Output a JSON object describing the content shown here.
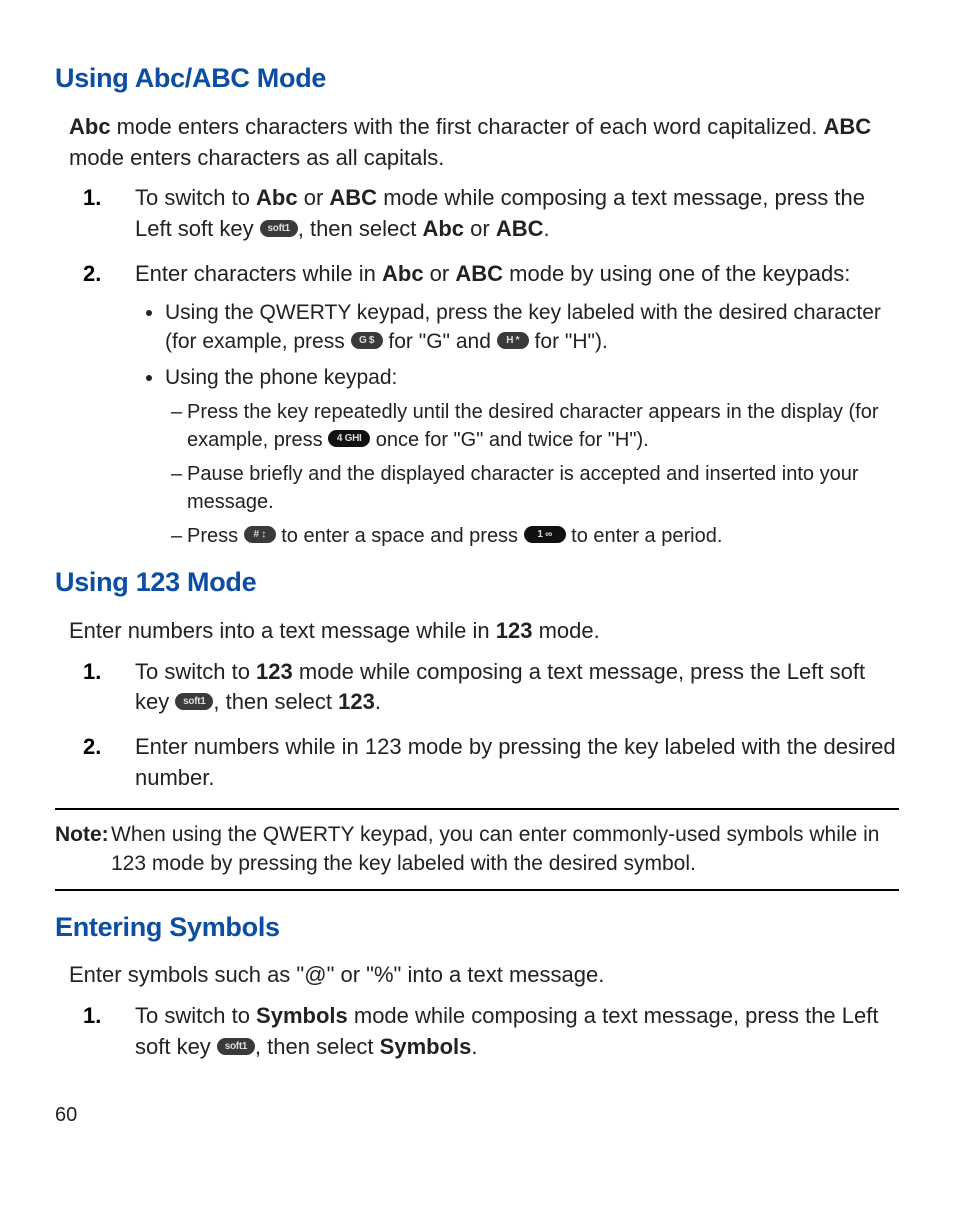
{
  "section1": {
    "heading": "Using Abc/ABC Mode",
    "intro_before_abc": "",
    "intro_abc": "Abc",
    "intro_between": " mode enters characters with the first character of each word capitalized. ",
    "intro_ABC": "ABC",
    "intro_after": " mode enters characters as all capitals.",
    "step1_num": "1.",
    "step1a": "To switch to ",
    "step1_abc": "Abc",
    "step1_or": " or ",
    "step1_ABC": "ABC",
    "step1b": " mode while composing a text message, press the Left soft key ",
    "step1_softkey": "soft1",
    "step1c": ", then select ",
    "step1_abc2": "Abc",
    "step1_or2": " or ",
    "step1_ABC2": "ABC",
    "step1d": ".",
    "step2_num": "2.",
    "step2a": "Enter characters while in ",
    "step2_abc": "Abc",
    "step2_or": " or ",
    "step2_ABC": "ABC",
    "step2b": " mode by using one of the keypads:",
    "bullet1a": "Using the QWERTY keypad, press the key labeled with the desired character (for example, press ",
    "bullet1_keyG": "G $",
    "bullet1b": " for \"G\" and ",
    "bullet1_keyH": "H *",
    "bullet1c": " for \"H\").",
    "bullet2": "Using the phone keypad:",
    "dash1a": "Press the key repeatedly until the desired character appears in the display (for example, press ",
    "dash1_key4": "4 GHI",
    "dash1b": " once for \"G\" and twice for \"H\").",
    "dash2": "Pause briefly and the displayed character is accepted and inserted into your message.",
    "dash3a": "Press ",
    "dash3_keyhash": "# ↕",
    "dash3b": " to enter a space and press ",
    "dash3_key1": "1 ∞",
    "dash3c": " to enter a period."
  },
  "section2": {
    "heading": "Using 123 Mode",
    "intro_a": "Enter numbers into a text message while in ",
    "intro_b": "123",
    "intro_c": " mode.",
    "step1_num": "1.",
    "step1a": "To switch to ",
    "step1_b": "123",
    "step1c": " mode while composing a text message, press the Left soft key ",
    "step1_softkey": "soft1",
    "step1d": ", then select ",
    "step1_e": "123",
    "step1f": ".",
    "step2_num": "2.",
    "step2": "Enter numbers while in 123 mode by pressing the key labeled with the desired number."
  },
  "note": {
    "label": "Note:",
    "body": " When using the QWERTY keypad, you can enter commonly-used symbols while in 123 mode by pressing the key labeled with the desired symbol."
  },
  "section3": {
    "heading": "Entering Symbols",
    "intro": "Enter symbols such as \"@\" or \"%\" into a text message.",
    "step1_num": "1.",
    "step1a": "To switch to ",
    "step1_b": "Symbols",
    "step1c": " mode while composing a text message, press the Left soft key ",
    "step1_softkey": "soft1",
    "step1d": ", then select ",
    "step1_e": "Symbols",
    "step1f": "."
  },
  "page": "60"
}
